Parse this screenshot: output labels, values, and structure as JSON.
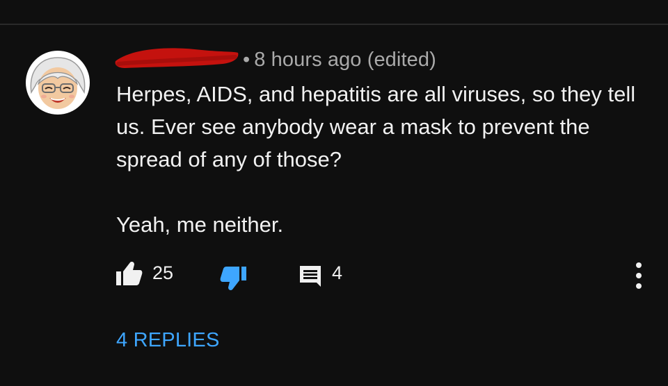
{
  "comment": {
    "author_redacted": true,
    "timestamp": "8 hours ago (edited)",
    "separator": "•",
    "body_lines": [
      "Herpes, AIDS, and hepatitis are all viruses, so they tell us. Ever see anybody wear a mask to prevent the spread of any of those?",
      "Yeah, me neither."
    ],
    "like_count": "25",
    "reply_count": "4",
    "replies_link": "4 REPLIES",
    "dislike_active": true
  },
  "icons": {
    "like": "thumbs-up-icon",
    "dislike": "thumbs-down-icon",
    "reply": "comment-icon",
    "more": "more-vertical-icon"
  },
  "colors": {
    "background": "#0f0f0f",
    "text": "#f1f1f1",
    "meta": "#aaaaaa",
    "accent": "#3ea6ff",
    "redaction": "#c4120e"
  }
}
